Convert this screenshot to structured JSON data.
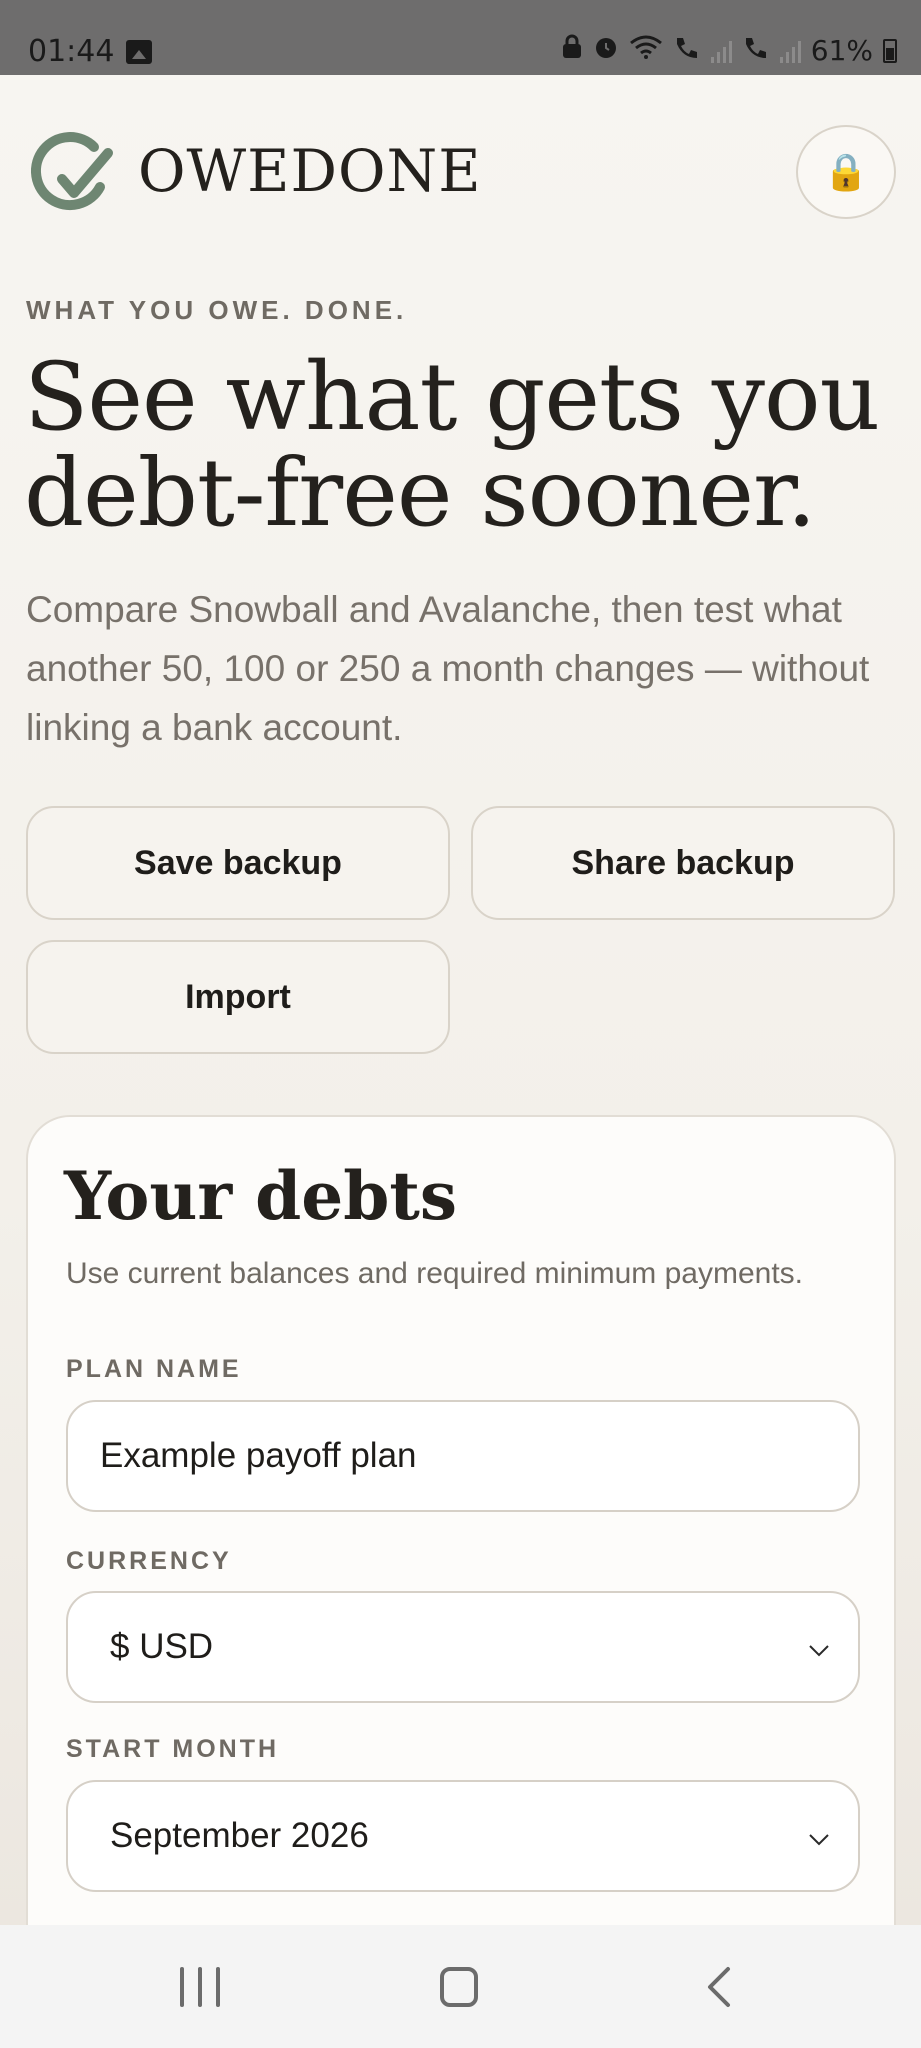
{
  "status_bar": {
    "time": "01:44",
    "battery": "61%",
    "icons": [
      "gallery-icon",
      "android-lock-icon",
      "alarm-icon",
      "wifi-icon",
      "call-sim1-icon",
      "signal-icon",
      "call-sim2-icon",
      "signal-icon",
      "battery-icon"
    ]
  },
  "header": {
    "brand": "OWEDONE",
    "lock_icon": "🔒",
    "logo_color": "#6e8672"
  },
  "hero": {
    "eyebrow": "WHAT YOU OWE. DONE.",
    "title": "See what gets you debt-free sooner.",
    "subtitle": "Compare Snowball and Avalanche, then test what another 50, 100 or 250 a month changes — without linking a bank account."
  },
  "actions": {
    "save_label": "Save backup",
    "share_label": "Share backup",
    "import_label": "Import"
  },
  "debts_card": {
    "title": "Your debts",
    "help": "Use current balances and required minimum payments.",
    "plan_name_label": "PLAN NAME",
    "plan_name_value": "Example payoff plan",
    "currency_label": "CURRENCY",
    "currency_value": "$ USD",
    "start_month_label": "START MONTH",
    "start_month_value": "September 2026"
  },
  "nav": {
    "icons": [
      "recent-apps-icon",
      "home-icon",
      "back-icon"
    ]
  }
}
